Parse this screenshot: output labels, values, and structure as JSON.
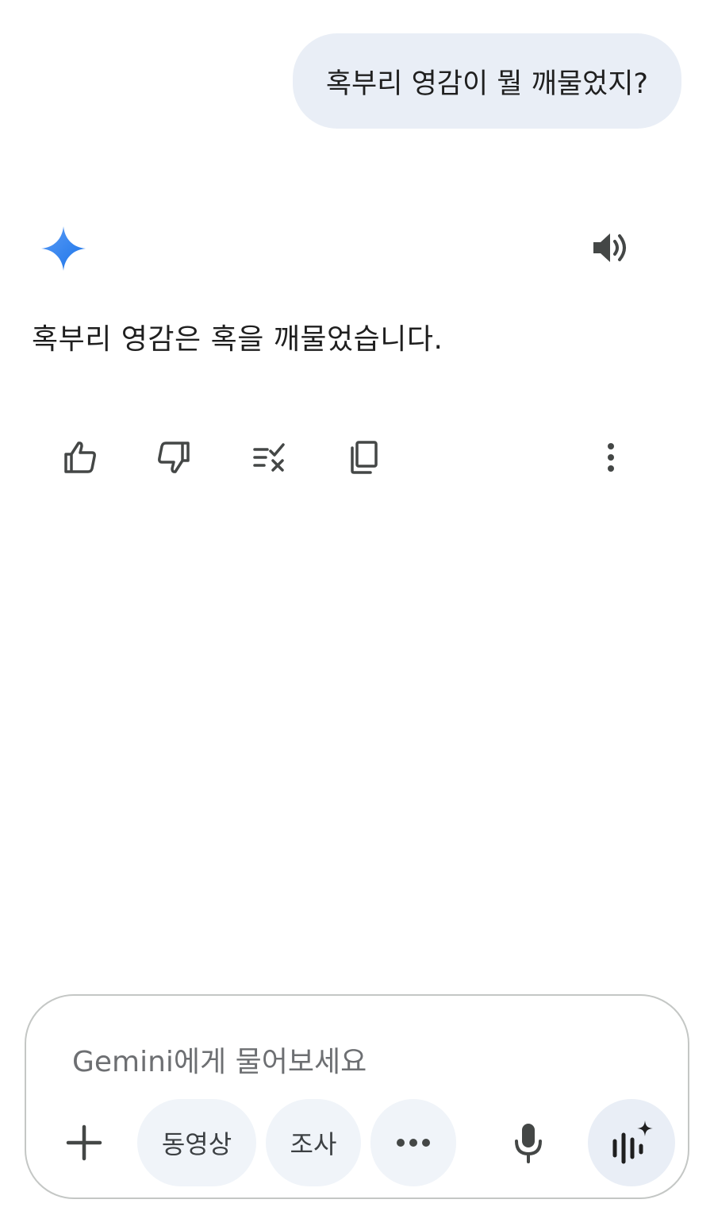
{
  "conversation": {
    "user_message": "혹부리 영감이 뭘 깨물었지?",
    "assistant_message": "혹부리 영감은 혹을 깨물었습니다."
  },
  "response_actions": {
    "icons": [
      "thumb-up-icon",
      "thumb-down-icon",
      "modify-response-icon",
      "copy-icon",
      "more-vert-icon"
    ]
  },
  "composer": {
    "placeholder": "Gemini에게 물어보세요",
    "chips": {
      "video": "동영상",
      "research": "조사"
    }
  },
  "colors": {
    "gemini_gradient_start": "#4285f4",
    "gemini_gradient_end": "#1a73e8",
    "bubble_bg": "#e9eef6",
    "chip_bg": "#f0f4f9",
    "icon_gray": "#444746"
  }
}
